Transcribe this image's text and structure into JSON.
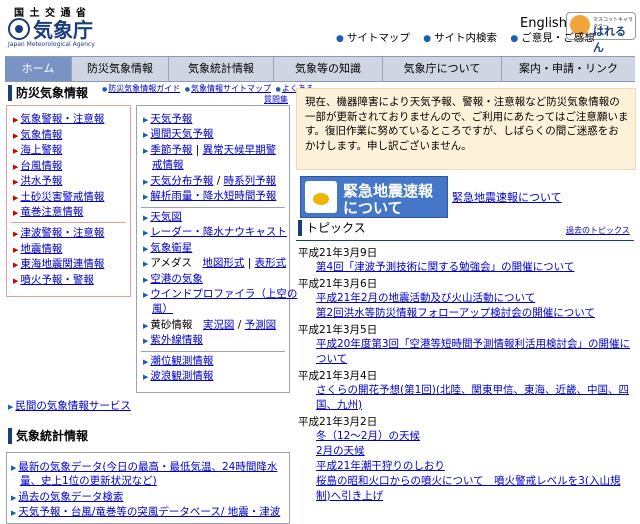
{
  "header": {
    "ministry": "国 土 交 通 省",
    "agency_name": "気象庁",
    "agency_en": "Japan Meteorological Agency",
    "english": "English",
    "mascot_small": "マスコットキャラクター",
    "mascot_name": "はれるん",
    "top_links": [
      "サイトマップ",
      "サイト内検索",
      "ご意見・ご感想"
    ]
  },
  "nav": [
    "ホーム",
    "防災気象情報",
    "気象統計情報",
    "気象等の知識",
    "気象庁について",
    "案内・申請・リンク"
  ],
  "bosai": {
    "title": "防災気象情報",
    "sublinks": [
      "防災気象情報ガイド",
      "気象情報サイトマップ",
      "よくある",
      "質問集"
    ],
    "red_list_a": [
      "気象警報・注意報",
      "気象情報",
      "海上警報",
      "台風情報",
      "洪水予報",
      "土砂災害警戒情報",
      "竜巻注意情報"
    ],
    "red_list_b": [
      "津波警報・注意報",
      "地震情報",
      "東海地震関連情報",
      "噴火予報・警報"
    ],
    "blue_list_a": [
      "天気予報",
      "週間天気予報"
    ],
    "kisetsu_1": "季節予報",
    "kisetsu_sep": " | ",
    "kisetsu_2": "異常天候早期警",
    "kisetsu_3": "戒情報",
    "bunpu_1": "天気分布予報",
    "bunpu_2": "時系列予報",
    "kaiseki": "解析雨量・降水短時間予報",
    "blue_list_b": [
      "天気図",
      "レーダー・降水ナウキャスト",
      "気象衛星"
    ],
    "amedas": "アメダス",
    "amedas_1": "地図形式",
    "amedas_sep": " | ",
    "amedas_2": "表形式",
    "kukou": "空港の気象",
    "wind_1": "ウインドプロファイラ（上空の",
    "wind_2": "風）",
    "kosa": "黄砂情報",
    "kosa_1": "実況図",
    "kosa_2": "予測図",
    "shigai": "紫外線情報",
    "blue_list_c": [
      "潮位観測情報",
      "波浪観測情報"
    ],
    "minkan": "民間の気象情報サービス"
  },
  "stats": {
    "title": "気象統計情報",
    "line1": "最新の気象データ(今日の最高・最低気温、24時間降水",
    "line2": "量、史上1位の更新状況など)",
    "line3": "過去の気象データ検索",
    "line4_1": "天気予報・台風",
    "line4_2": "/竜巻等の突風データベース",
    "line4_3": "/ 地震・津波"
  },
  "notice": "現在、機器障害により天気予報、警報・注意報など防災気象情報の一部が更新されておりませんので、ご利用にあたってはご注意願います。復旧作業に努めているところですが、しばらくの間ご迷惑をおかけします。申し訳ございません。",
  "eew": {
    "line1": "緊急地震速報",
    "line2": "について",
    "link": "緊急地震速報について"
  },
  "topics": {
    "title": "トピックス",
    "past": "過去のトピックス",
    "groups": [
      {
        "date": "平成21年3月9日",
        "items": [
          "第4回「津波予測技術に関する勉強会」の開催について"
        ]
      },
      {
        "date": "平成21年3月6日",
        "items": [
          "平成21年2月の地震活動及び火山活動について",
          "第2回洪水等防災情報フォローアップ検討会の開催について"
        ]
      },
      {
        "date": "平成21年3月5日",
        "items": [
          "平成20年度第3回「空港等短時間予測情報利活用検討会」の開催について"
        ]
      },
      {
        "date": "平成21年3月4日",
        "items": [
          "さくらの開花予想(第1回)(北陸、関東甲信、東海、近畿、中国、四国、九州)"
        ]
      },
      {
        "date": "平成21年3月2日",
        "items": [
          "冬（12～2月）の天候",
          "2月の天候",
          "平成21年潮干狩りのしおり",
          "桜島の昭和火口からの噴火について　噴火警戒レベルを3(入山規制)へ引き上げ"
        ]
      }
    ]
  }
}
